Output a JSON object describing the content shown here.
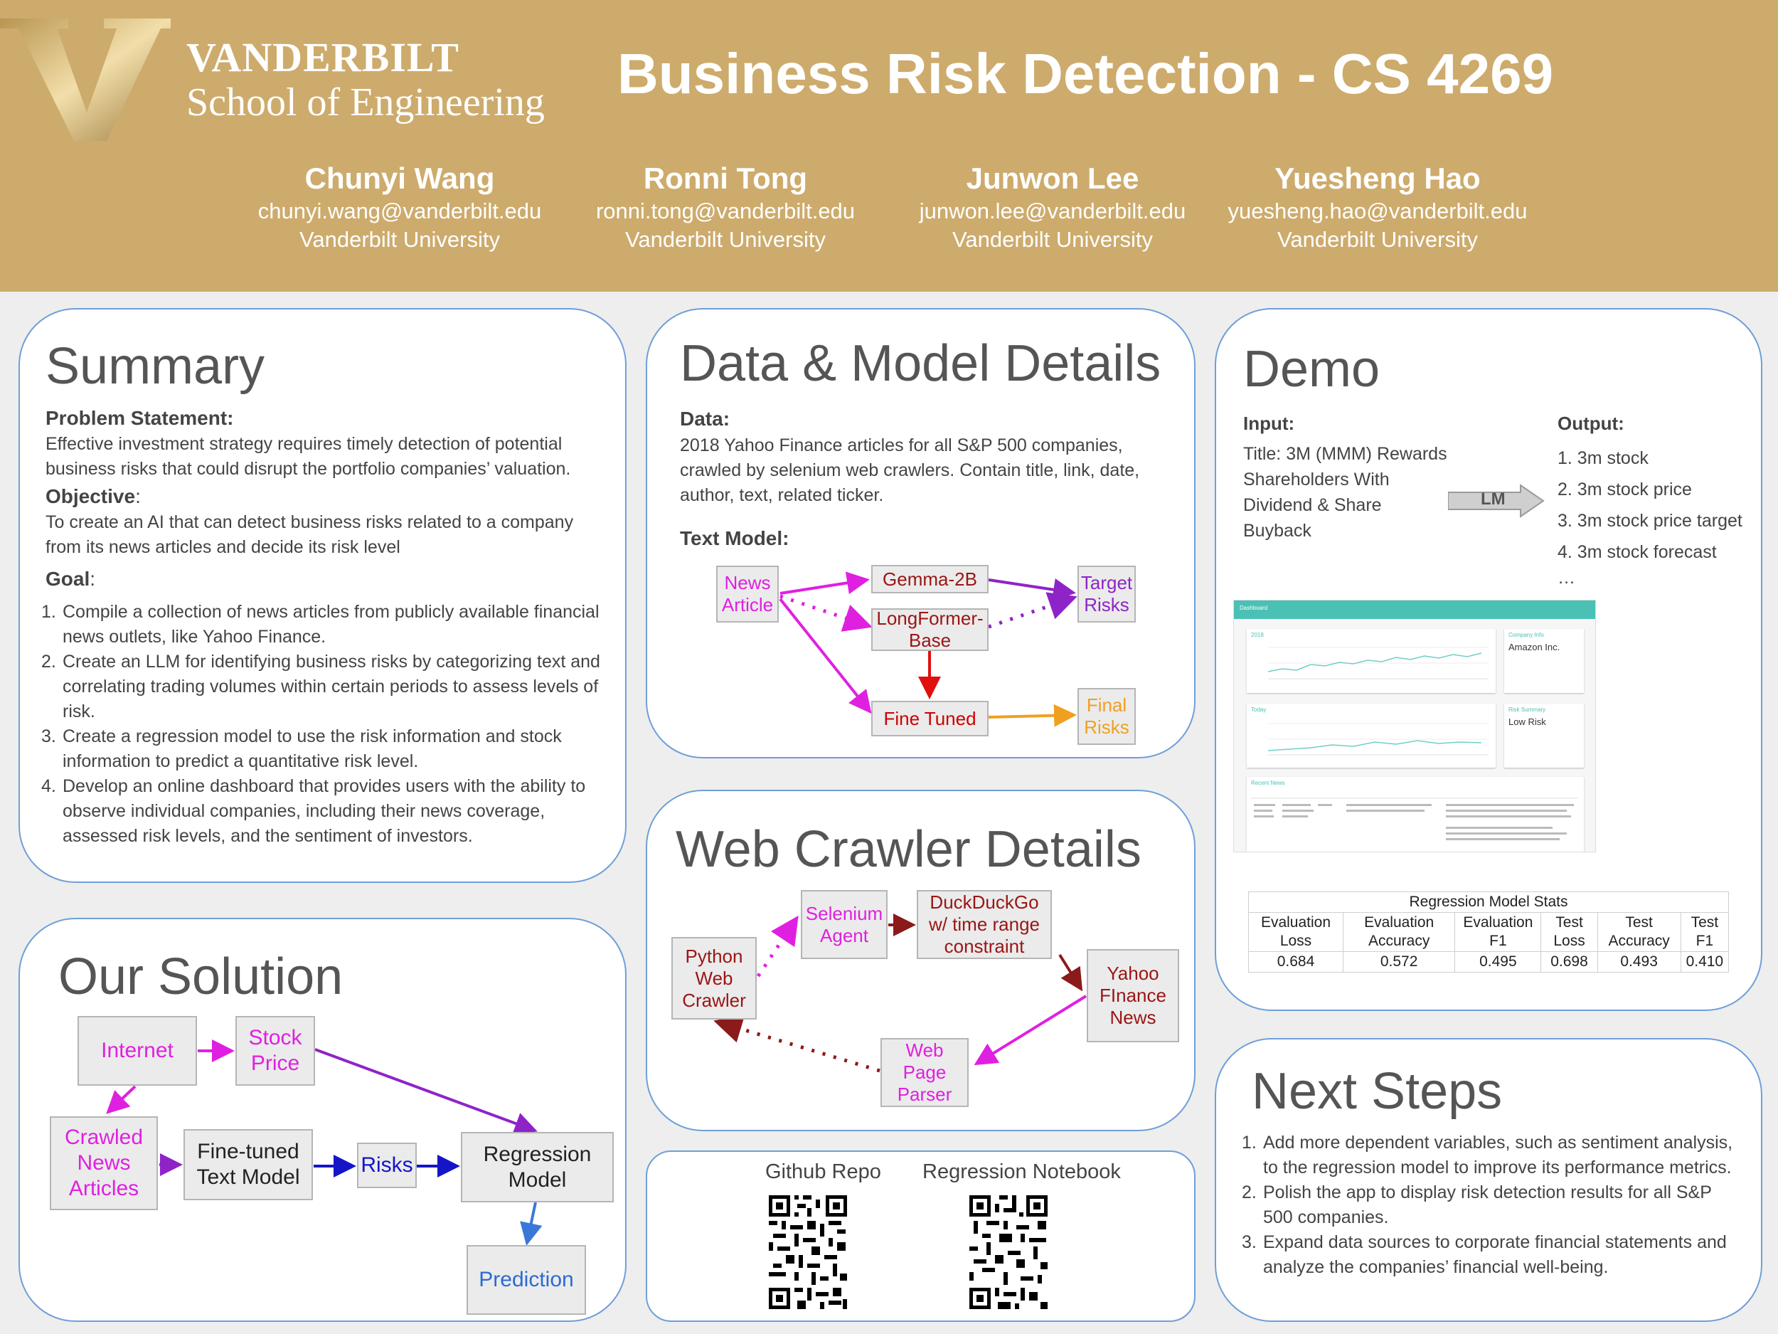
{
  "header": {
    "logo_line1": "VANDERBILT",
    "logo_line2": "School of Engineering",
    "title": "Business Risk Detection - CS 4269",
    "authors": [
      {
        "name": "Chunyi Wang",
        "email": "chunyi.wang@vanderbilt.edu",
        "affiliation": "Vanderbilt University"
      },
      {
        "name": "Ronni Tong",
        "email": "ronni.tong@vanderbilt.edu",
        "affiliation": "Vanderbilt University"
      },
      {
        "name": "Junwon Lee",
        "email": "junwon.lee@vanderbilt.edu",
        "affiliation": "Vanderbilt University"
      },
      {
        "name": "Yuesheng Hao",
        "email": "yuesheng.hao@vanderbilt.edu",
        "affiliation": "Vanderbilt University"
      }
    ]
  },
  "summary": {
    "title": "Summary",
    "problem_label": "Problem Statement:",
    "problem_text": "Effective investment strategy requires timely detection of potential business risks that could disrupt the portfolio companies’ valuation.",
    "objective_label": "Objective",
    "objective_colon": ":",
    "objective_text": "To create an AI that can detect business risks related to a company from its news articles and decide its risk level",
    "goal_label": "Goal",
    "goal_colon": ":",
    "goals": [
      "Compile a collection of news articles from publicly available financial news outlets, like Yahoo Finance.",
      "Create an LLM for identifying business risks by categorizing text and correlating trading volumes within certain periods to assess levels of risk.",
      "Create a regression model to use the risk information and stock information to predict a quantitative risk level.",
      "Develop an online dashboard that provides users with the ability to observe individual companies, including their news coverage, assessed risk levels, and the sentiment of investors."
    ]
  },
  "solution": {
    "title": "Our Solution",
    "nodes": {
      "internet": "Internet",
      "stock_price": "Stock Price",
      "crawled_news": "Crawled News Articles",
      "fine_tuned": "Fine-tuned Text Model",
      "risks": "Risks",
      "regression": "Regression Model",
      "prediction": "Prediction"
    }
  },
  "data_model": {
    "title": "Data & Model Details",
    "data_label": "Data:",
    "data_text": "2018 Yahoo Finance articles for all S&P 500 companies, crawled by selenium web crawlers. Contain title, link, date, author, text, related ticker.",
    "text_model_label": "Text Model:",
    "nodes": {
      "news_article": "News Article",
      "gemma": "Gemma-2B",
      "longformer": "LongFormer-Base",
      "target_risks": "Target Risks",
      "fine_tuned": "Fine Tuned",
      "final_risks": "Final Risks"
    }
  },
  "crawler": {
    "title": "Web Crawler Details",
    "nodes": {
      "python": "Python Web Crawler",
      "selenium": "Selenium Agent",
      "duckduckgo": "DuckDuckGo w/ time range constraint",
      "yahoo": "Yahoo FInance News",
      "parser": "Web Page Parser"
    }
  },
  "links": {
    "github": "Github Repo",
    "notebook": "Regression Notebook"
  },
  "demo": {
    "title": "Demo",
    "input_label": "Input:",
    "input_text": "Title: 3M (MMM) Rewards Shareholders With Dividend & Share Buyback",
    "lm_label": "LM",
    "output_label": "Output:",
    "outputs": [
      "1. 3m stock",
      "2. 3m stock price",
      "3. 3m stock price target",
      "4. 3m stock forecast",
      "…"
    ],
    "dashboard": {
      "bar_title": "Dashboard",
      "card1_title": "Company Info",
      "card1_value": "Amazon Inc.",
      "card2_title": "Risk Summary",
      "card2_value": "Low Risk",
      "chart1_title": "2018",
      "chart2_title": "Today",
      "news_title": "Recent News"
    },
    "table": {
      "caption": "Regression Model Stats",
      "headers": [
        "Evaluation Loss",
        "Evaluation Accuracy",
        "Evaluation F1",
        "Test Loss",
        "Test Accuracy",
        "Test F1"
      ],
      "values": [
        "0.684",
        "0.572",
        "0.495",
        "0.698",
        "0.493",
        "0.410"
      ]
    }
  },
  "next_steps": {
    "title": "Next Steps",
    "items": [
      "Add more dependent variables, such as sentiment analysis, to the regression model to improve its performance metrics.",
      "Polish the app to display risk detection results for all S&P 500 companies.",
      "Expand data sources to corporate financial statements and analyze the companies’ financial well-being."
    ]
  },
  "colors": {
    "header_gold": "#cdab6c",
    "panel_border": "#6f9fd8",
    "magenta": "#e020e0",
    "purple": "#8e24c8",
    "dark_red": "#9b1515",
    "blue": "#1515c8",
    "orange": "#f0a020"
  }
}
